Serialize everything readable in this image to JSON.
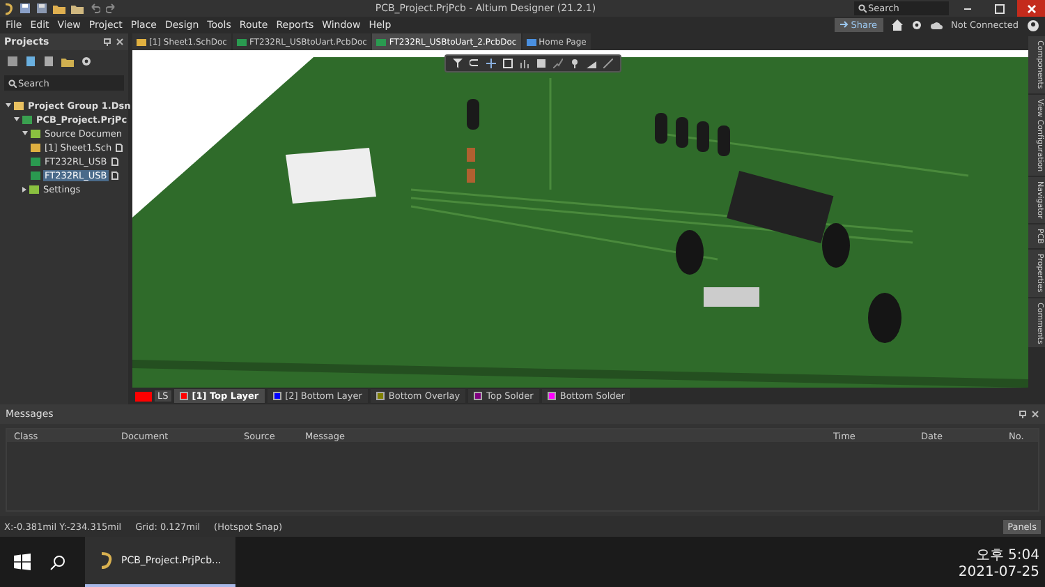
{
  "window": {
    "title": "PCB_Project.PrjPcb - Altium Designer (21.2.1)",
    "search_placeholder": "Search"
  },
  "menu": [
    "File",
    "Edit",
    "View",
    "Project",
    "Place",
    "Design",
    "Tools",
    "Route",
    "Reports",
    "Window",
    "Help"
  ],
  "account": {
    "share": "Share",
    "status": "Not Connected"
  },
  "projects_panel": {
    "title": "Projects",
    "search_placeholder": "Search",
    "tree": [
      {
        "label": "Project Group 1.Dsn",
        "kind": "group",
        "selected": false,
        "expanded": true,
        "children": [
          {
            "label": "PCB_Project.PrjPc",
            "kind": "project",
            "selected": false,
            "expanded": true,
            "children": [
              {
                "label": "Source Documen",
                "kind": "folder",
                "selected": false,
                "expanded": true,
                "children": [
                  {
                    "label": "[1] Sheet1.Sch",
                    "kind": "sch",
                    "selected": false
                  },
                  {
                    "label": "FT232RL_USB",
                    "kind": "pcb",
                    "selected": false
                  },
                  {
                    "label": "FT232RL_USB",
                    "kind": "pcb",
                    "selected": true
                  }
                ]
              },
              {
                "label": "Settings",
                "kind": "folder",
                "selected": false,
                "expanded": false
              }
            ]
          }
        ]
      }
    ]
  },
  "doc_tabs": [
    {
      "label": "[1] Sheet1.SchDoc",
      "kind": "sch",
      "selected": false
    },
    {
      "label": "FT232RL_USBtoUart.PcbDoc",
      "kind": "pcb",
      "selected": false
    },
    {
      "label": "FT232RL_USBtoUart_2.PcbDoc",
      "kind": "pcb",
      "selected": true
    },
    {
      "label": "Home Page",
      "kind": "home",
      "selected": false
    }
  ],
  "side_tabs": [
    "Components",
    "View Configuration",
    "Navigator",
    "PCB",
    "Properties",
    "Comments"
  ],
  "layer_set": {
    "label": "LS",
    "color": "#ff0000"
  },
  "layer_tabs": [
    {
      "label": "[1] Top Layer",
      "color": "#ff0000",
      "selected": true
    },
    {
      "label": "[2] Bottom Layer",
      "color": "#0000ff",
      "selected": false
    },
    {
      "label": "Bottom Overlay",
      "color": "#808000",
      "selected": false
    },
    {
      "label": "Top Solder",
      "color": "#800080",
      "selected": false
    },
    {
      "label": "Bottom Solder",
      "color": "#ff00ff",
      "selected": false
    }
  ],
  "messages": {
    "title": "Messages",
    "columns": [
      "Class",
      "Document",
      "Source",
      "Message",
      "Time",
      "Date",
      "No."
    ]
  },
  "status_bar": {
    "coords": "X:-0.381mil Y:-234.315mil",
    "grid": "Grid: 0.127mil",
    "snap": "(Hotspot Snap)",
    "panels": "Panels"
  },
  "taskbar": {
    "app": "PCB_Project.PrjPcb...",
    "time": "오후 5:04",
    "date": "2021-07-25"
  }
}
